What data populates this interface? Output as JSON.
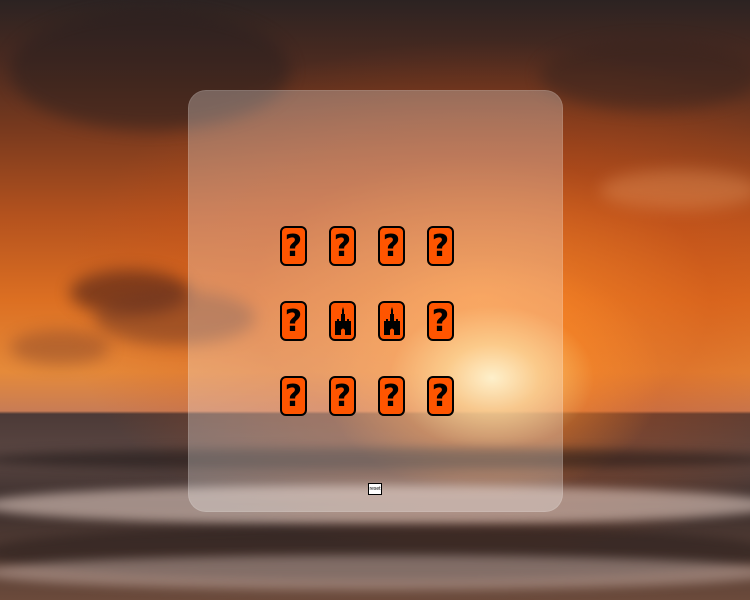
{
  "scene": {
    "background": "sunset-over-ocean",
    "panel_color": "rgba(255,255,255,0.28)",
    "card_color": "#ff5500"
  },
  "board": {
    "rows": [
      [
        {
          "state": "hidden",
          "face": "?"
        },
        {
          "state": "hidden",
          "face": "?"
        },
        {
          "state": "hidden",
          "face": "?"
        },
        {
          "state": "hidden",
          "face": "?"
        }
      ],
      [
        {
          "state": "hidden",
          "face": "?"
        },
        {
          "state": "revealed",
          "face": "castle-icon"
        },
        {
          "state": "revealed",
          "face": "castle-icon"
        },
        {
          "state": "hidden",
          "face": "?"
        }
      ],
      [
        {
          "state": "hidden",
          "face": "?"
        },
        {
          "state": "hidden",
          "face": "?"
        },
        {
          "state": "hidden",
          "face": "?"
        },
        {
          "state": "hidden",
          "face": "?"
        }
      ]
    ]
  },
  "controls": {
    "reset_label": "reset"
  }
}
